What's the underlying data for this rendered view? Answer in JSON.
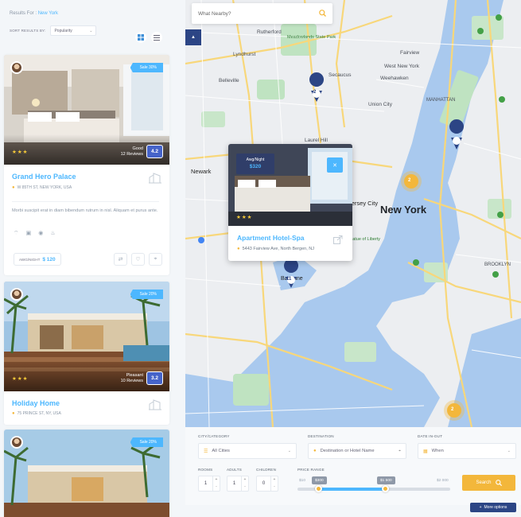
{
  "sidebar": {
    "results_prefix": "Results For :",
    "results_query": "New York",
    "sort_label": "SORT RESULTS BY:",
    "sort_value": "Popularity"
  },
  "cards": [
    {
      "sale": "Sale 30%",
      "rating_word": "Good",
      "reviews": "12 Reviews",
      "score": "4.2",
      "title": "Grand Hero Palace",
      "address": "W 85TH ST, NEW YORK, USA",
      "description": "Morbi suscipit erat in diam bibendum rutrum in nisl. Aliquam et purus ante.",
      "price_label": "AWG/NIGHT",
      "price": "$ 120"
    },
    {
      "sale": "Sale 20%",
      "rating_word": "Pleasant",
      "reviews": "10 Reviews",
      "score": "3.2",
      "title": "Holiday Home",
      "address": "75 PRINCE ST, NY, USA"
    },
    {
      "sale": "Sale 20%"
    }
  ],
  "map": {
    "search_placeholder": "What Nearby?",
    "city_label": "New York",
    "markers": [
      "2",
      "11",
      "2"
    ],
    "popup": {
      "badge_label": "Awg/Night",
      "badge_price": "$320",
      "title": "Apartment Hotel-Spa",
      "address": "5443 Fairview Ave, North Bergen, NJ"
    },
    "places": [
      "Rutherford",
      "Meadowlands State Park",
      "Lyndhurst",
      "Belleville",
      "Secaucus",
      "Laurel Hill",
      "Weehawken",
      "Union City",
      "Newark",
      "Jersey City",
      "Bayonne",
      "Fairview",
      "West New York",
      "MANHATTAN",
      "BROOKLYN",
      "Statue of Liberty"
    ]
  },
  "filters": {
    "city_label": "CITY/CATEGORY",
    "city_value": "All Cities",
    "destination_label": "DESTINATION",
    "destination_placeholder": "Destination or Hotel Name",
    "date_label": "DATE IN-OUT",
    "date_placeholder": "When",
    "rooms_label": "ROOMS",
    "rooms_value": "1",
    "adults_label": "ADULTS",
    "adults_value": "1",
    "children_label": "CHILDREN",
    "children_value": "0",
    "price_label": "PRICE RANGE",
    "price_min_label": "$10",
    "price_from": "$300",
    "price_to": "$1 500",
    "price_max_label": "$2 000",
    "search_button": "Search",
    "more_options": "More options"
  }
}
